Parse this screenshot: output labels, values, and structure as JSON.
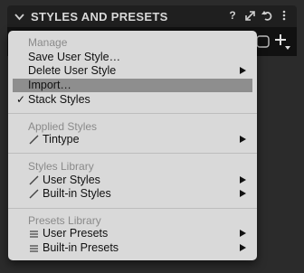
{
  "panel": {
    "title": "STYLES AND PRESETS"
  },
  "menu": {
    "manage": {
      "header": "Manage",
      "save": "Save User Style…",
      "delete": "Delete User Style",
      "import": "Import…",
      "stack": "Stack Styles",
      "stack_checked": "✓"
    },
    "applied": {
      "header": "Applied Styles",
      "tintype": "Tintype"
    },
    "library": {
      "header": "Styles Library",
      "user": "User Styles",
      "builtin": "Built-in Styles"
    },
    "presets": {
      "header": "Presets Library",
      "user": "User Presets",
      "builtin": "Built-in Presets"
    }
  },
  "colors": {
    "highlight": "#8e8e8e",
    "menu_bg": "#d9d9d9",
    "header_bg": "#1f1f1f"
  }
}
